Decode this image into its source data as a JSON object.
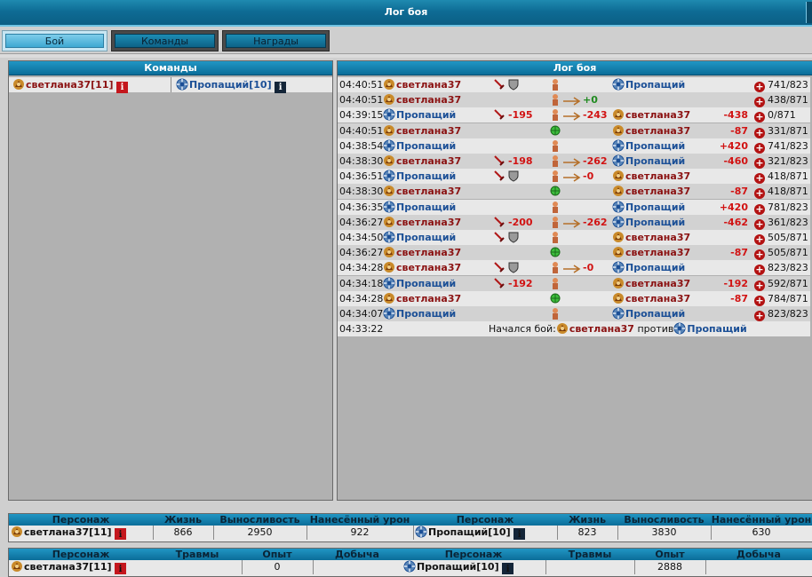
{
  "window": {
    "title": "Лог боя"
  },
  "tabs": [
    {
      "label": "Бой",
      "active": true
    },
    {
      "label": "Команды",
      "active": false
    },
    {
      "label": "Награды",
      "active": false
    }
  ],
  "teams_panel": {
    "title": "Команды",
    "team1": {
      "name": "светлана37",
      "level": "[11]"
    },
    "team2": {
      "name": "Пропащий",
      "level": "[10]"
    }
  },
  "log_panel": {
    "title": "Лог боя",
    "rows": [
      {
        "time": "04:40:51",
        "actor": "светлана37",
        "actor_side": "red",
        "weapons": "",
        "weapon_dmg": "",
        "mid": "",
        "mid_val": "",
        "target": "Пропащий",
        "target_side": "blue",
        "result": "",
        "hp": "741/823"
      },
      {
        "time": "04:40:51",
        "actor": "светлана37",
        "actor_side": "red",
        "weapons": "",
        "weapon_dmg": "",
        "mid": "",
        "mid_val": "+0",
        "target": "",
        "target_side": "",
        "result": "",
        "hp": "438/871"
      },
      {
        "time": "04:39:15",
        "actor": "Пропащий",
        "actor_side": "blue",
        "weapons": "",
        "weapon_dmg": "-195",
        "mid": "",
        "mid_val": "-243",
        "target": "светлана37",
        "target_side": "red",
        "result": "-438",
        "hp": "0/871"
      },
      {
        "time": "04:40:51",
        "actor": "светлана37",
        "actor_side": "red",
        "weapons": "",
        "weapon_dmg": "",
        "mid": "",
        "mid_val": "",
        "target": "светлана37",
        "target_side": "red",
        "result": "-87",
        "hp": "331/871"
      },
      {
        "time": "04:38:54",
        "actor": "Пропащий",
        "actor_side": "blue",
        "weapons": "",
        "weapon_dmg": "",
        "mid": "",
        "mid_val": "",
        "target": "Пропащий",
        "target_side": "blue",
        "result": "+420",
        "hp": "741/823"
      },
      {
        "time": "04:38:30",
        "actor": "светлана37",
        "actor_side": "red",
        "weapons": "",
        "weapon_dmg": "-198",
        "mid": "",
        "mid_val": "-262",
        "target": "Пропащий",
        "target_side": "blue",
        "result": "-460",
        "hp": "321/823"
      },
      {
        "time": "04:36:51",
        "actor": "Пропащий",
        "actor_side": "blue",
        "weapons": "",
        "weapon_dmg": "",
        "mid": "",
        "mid_val": "-0",
        "target": "светлана37",
        "target_side": "red",
        "result": "",
        "hp": "418/871"
      },
      {
        "time": "04:38:30",
        "actor": "светлана37",
        "actor_side": "red",
        "weapons": "",
        "weapon_dmg": "",
        "mid": "",
        "mid_val": "",
        "target": "светлана37",
        "target_side": "red",
        "result": "-87",
        "hp": "418/871"
      },
      {
        "time": "04:36:35",
        "actor": "Пропащий",
        "actor_side": "blue",
        "weapons": "",
        "weapon_dmg": "",
        "mid": "",
        "mid_val": "",
        "target": "Пропащий",
        "target_side": "blue",
        "result": "+420",
        "hp": "781/823"
      },
      {
        "time": "04:36:27",
        "actor": "светлана37",
        "actor_side": "red",
        "weapons": "",
        "weapon_dmg": "-200",
        "mid": "",
        "mid_val": "-262",
        "target": "Пропащий",
        "target_side": "blue",
        "result": "-462",
        "hp": "361/823"
      },
      {
        "time": "04:34:50",
        "actor": "Пропащий",
        "actor_side": "blue",
        "weapons": "",
        "weapon_dmg": "",
        "mid": "",
        "mid_val": "",
        "target": "светлана37",
        "target_side": "red",
        "result": "",
        "hp": "505/871"
      },
      {
        "time": "04:36:27",
        "actor": "светлана37",
        "actor_side": "red",
        "weapons": "",
        "weapon_dmg": "",
        "mid": "",
        "mid_val": "",
        "target": "светлана37",
        "target_side": "red",
        "result": "-87",
        "hp": "505/871"
      },
      {
        "time": "04:34:28",
        "actor": "светлана37",
        "actor_side": "red",
        "weapons": "",
        "weapon_dmg": "",
        "mid": "",
        "mid_val": "-0",
        "target": "Пропащий",
        "target_side": "blue",
        "result": "",
        "hp": "823/823"
      },
      {
        "time": "04:34:18",
        "actor": "Пропащий",
        "actor_side": "blue",
        "weapons": "",
        "weapon_dmg": "-192",
        "mid": "",
        "mid_val": "",
        "target": "светлана37",
        "target_side": "red",
        "result": "-192",
        "hp": "592/871"
      },
      {
        "time": "04:34:28",
        "actor": "светлана37",
        "actor_side": "red",
        "weapons": "",
        "weapon_dmg": "",
        "mid": "",
        "mid_val": "",
        "target": "светлана37",
        "target_side": "red",
        "result": "-87",
        "hp": "784/871"
      },
      {
        "time": "04:34:07",
        "actor": "Пропащий",
        "actor_side": "blue",
        "weapons": "",
        "weapon_dmg": "",
        "mid": "",
        "mid_val": "",
        "target": "Пропащий",
        "target_side": "blue",
        "result": "",
        "hp": "823/823"
      }
    ],
    "start_row": {
      "time": "04:33:22",
      "text": "Начался бой:",
      "p1": "светлана37",
      "vs": "против",
      "p2": "Пропащий"
    }
  },
  "stats": {
    "headers": [
      "Персонаж",
      "Жизнь",
      "Выносливость",
      "Нанесённый урон",
      "Персонаж",
      "Жизнь",
      "Выносливость",
      "Нанесённый урон"
    ],
    "p1": {
      "name": "светлана37",
      "level": "[11]",
      "life": "866",
      "stamina": "2950",
      "damage": "922"
    },
    "p2": {
      "name": "Пропащий",
      "level": "[10]",
      "life": "823",
      "stamina": "3830",
      "damage": "630"
    }
  },
  "rewards": {
    "headers": [
      "Персонаж",
      "Травмы",
      "Опыт",
      "Добыча",
      "Персонаж",
      "Травмы",
      "Опыт",
      "Добыча"
    ],
    "p1": {
      "name": "светлана37",
      "level": "[11]",
      "injuries": "",
      "exp": "0",
      "loot": ""
    },
    "p2": {
      "name": "Пропащий",
      "level": "[10]",
      "injuries": "",
      "exp": "2888",
      "loot": ""
    }
  }
}
